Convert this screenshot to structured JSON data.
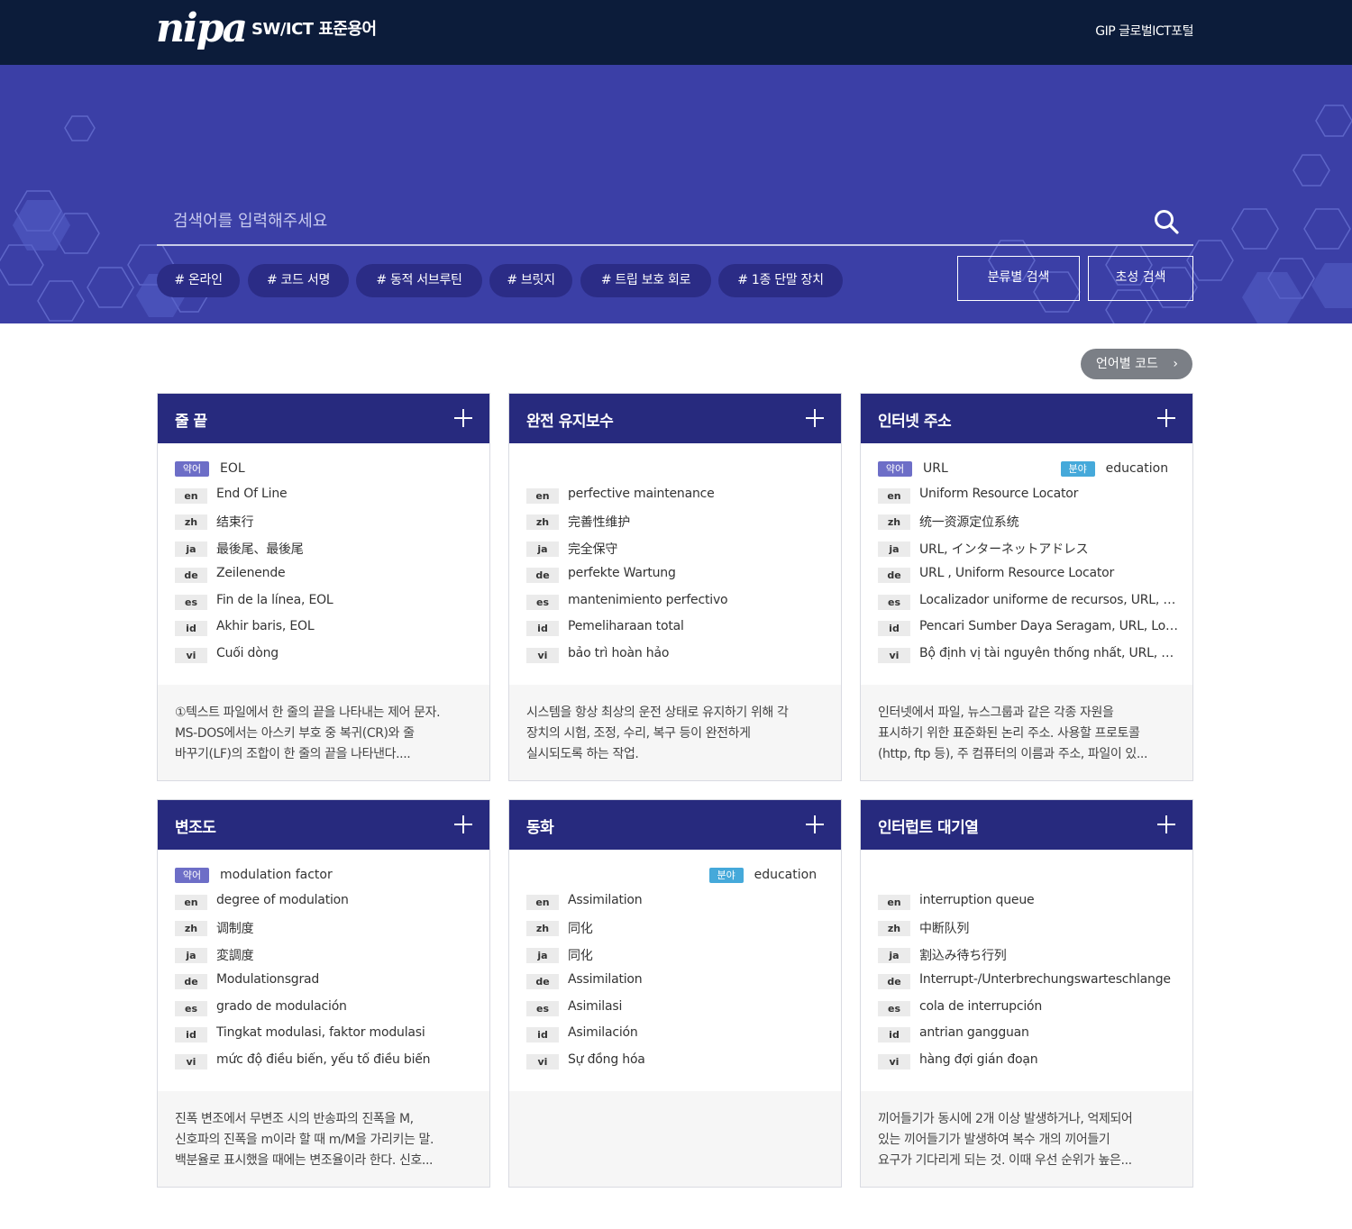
{
  "header": {
    "logo": "nipa",
    "site_title": "SW/ICT 표준용어",
    "portal_link": "GIP 글로벌ICT포털"
  },
  "search": {
    "placeholder": "검색어를 입력해주세요",
    "tags": [
      "# 온라인",
      "# 코드 서명",
      "# 동적 서브루틴",
      "# 브릿지",
      "# 트립 보호 회로",
      "# 1종 단말 장치"
    ],
    "category_button": "분류별 검색",
    "initial_button": "초성 검색"
  },
  "lang_code_button": "언어별 코드",
  "colors": {
    "header_bg": "#0c1c3a",
    "hero_bg": "#3b3fa6",
    "card_head": "#272a7e",
    "abbr_badge": "#6d6ec7",
    "field_badge": "#45a9da"
  },
  "labels": {
    "abbr": "약어",
    "field": "분야"
  },
  "cards": [
    {
      "title": "줄 끝",
      "abbr": "EOL",
      "field": "",
      "langs": [
        {
          "code": "en",
          "term": "End Of Line"
        },
        {
          "code": "zh",
          "term": "结束行"
        },
        {
          "code": "ja",
          "term": "最後尾、最後尾"
        },
        {
          "code": "de",
          "term": "Zeilenende"
        },
        {
          "code": "es",
          "term": "Fin de la línea, EOL"
        },
        {
          "code": "id",
          "term": "Akhir baris, EOL"
        },
        {
          "code": "vi",
          "term": "Cuối dòng"
        }
      ],
      "desc": "①텍스트 파일에서 한 줄의 끝을 나타내는 제어 문자.\nMS-DOS에서는 아스키 부호 중 복귀(CR)와 줄\n바꾸기(LF)의 조합이 한 줄의 끝을 나타낸다...."
    },
    {
      "title": "완전 유지보수",
      "abbr": "",
      "field": "",
      "langs": [
        {
          "code": "en",
          "term": "perfective maintenance"
        },
        {
          "code": "zh",
          "term": "完善性维护"
        },
        {
          "code": "ja",
          "term": "完全保守"
        },
        {
          "code": "de",
          "term": "perfekte Wartung"
        },
        {
          "code": "es",
          "term": "mantenimiento perfectivo"
        },
        {
          "code": "id",
          "term": "Pemeliharaan total"
        },
        {
          "code": "vi",
          "term": "bảo trì hoàn hảo"
        }
      ],
      "desc": "시스템을 항상 최상의 운전 상태로 유지하기 위해 각\n장치의 시험, 조정, 수리, 복구 등이 완전하게\n실시되도록 하는 작업."
    },
    {
      "title": "인터넷 주소",
      "abbr": "URL",
      "field": "education",
      "langs": [
        {
          "code": "en",
          "term": "Uniform Resource Locator"
        },
        {
          "code": "zh",
          "term": "统一资源定位系统"
        },
        {
          "code": "ja",
          "term": "URL, インターネットアドレス"
        },
        {
          "code": "de",
          "term": "URL , Uniform Resource Locator"
        },
        {
          "code": "es",
          "term": "Localizador uniforme de recursos, URL, Pen..."
        },
        {
          "code": "id",
          "term": "Pencari Sumber Daya Seragam, URL, Locali..."
        },
        {
          "code": "vi",
          "term": "Bộ định vị tài nguyên thống nhất, URL, Địn..."
        }
      ],
      "desc": "인터넷에서 파일, 뉴스그룹과 같은 각종 자원을\n표시하기 위한 표준화된 논리 주소. 사용할 프로토콜\n(http, ftp 등), 주 컴퓨터의 이름과 주소, 파일이 있..."
    },
    {
      "title": "변조도",
      "abbr": "modulation factor",
      "field": "",
      "langs": [
        {
          "code": "en",
          "term": "degree of modulation"
        },
        {
          "code": "zh",
          "term": "调制度"
        },
        {
          "code": "ja",
          "term": "変調度"
        },
        {
          "code": "de",
          "term": "Modulationsgrad"
        },
        {
          "code": "es",
          "term": "grado de modulación"
        },
        {
          "code": "id",
          "term": "Tingkat modulasi, faktor modulasi"
        },
        {
          "code": "vi",
          "term": "mức độ điều biến, yếu tố điều biến"
        }
      ],
      "desc": "진폭 변조에서 무변조 시의 반송파의 진폭을 M,\n신호파의 진폭을 m이라 할 때 m/M을 가리키는 말.\n백분율로 표시했을 때에는 변조율이라 한다. 신호..."
    },
    {
      "title": "동화",
      "abbr": "",
      "field": "education",
      "langs": [
        {
          "code": "en",
          "term": "Assimilation"
        },
        {
          "code": "zh",
          "term": "同化"
        },
        {
          "code": "ja",
          "term": "同化"
        },
        {
          "code": "de",
          "term": "Assimilation"
        },
        {
          "code": "es",
          "term": "Asimilasi"
        },
        {
          "code": "id",
          "term": "Asimilación"
        },
        {
          "code": "vi",
          "term": "Sự đồng hóa"
        }
      ],
      "desc": ""
    },
    {
      "title": "인터럽트 대기열",
      "abbr": "",
      "field": "",
      "langs": [
        {
          "code": "en",
          "term": "interruption queue"
        },
        {
          "code": "zh",
          "term": "中断队列"
        },
        {
          "code": "ja",
          "term": "割込み待ち行列"
        },
        {
          "code": "de",
          "term": "Interrupt-/Unterbrechungswarteschlange"
        },
        {
          "code": "es",
          "term": "cola de interrupción"
        },
        {
          "code": "id",
          "term": "antrian gangguan"
        },
        {
          "code": "vi",
          "term": "hàng đợi gián đoạn"
        }
      ],
      "desc": "끼어들기가 동시에 2개 이상 발생하거나, 억제되어\n있는 끼어들기가 발생하여 복수 개의 끼어들기\n요구가 기다리게 되는 것. 이때 우선 순위가 높은..."
    }
  ]
}
